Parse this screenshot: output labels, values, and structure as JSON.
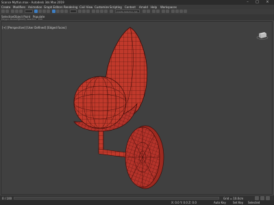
{
  "titlebar": {
    "title": "Sconce Mytfun.max - Autodesk 3ds Max 2019"
  },
  "menu": [
    {
      "key": "create",
      "label": "Create"
    },
    {
      "key": "modifiers",
      "label": "Modifiers"
    },
    {
      "key": "animation",
      "label": "Animation"
    },
    {
      "key": "graph_editors",
      "label": "Graph Editors"
    },
    {
      "key": "rendering",
      "label": "Rendering"
    },
    {
      "key": "civil_view",
      "label": "Civil View"
    },
    {
      "key": "customize",
      "label": "Customize"
    },
    {
      "key": "scripting",
      "label": "Scripting"
    },
    {
      "key": "content",
      "label": "Content"
    },
    {
      "key": "arnold",
      "label": "Arnold"
    },
    {
      "key": "help",
      "label": "Help"
    },
    {
      "key": "workspaces",
      "label": "Workspaces"
    }
  ],
  "toolbar": {
    "selection_set_placeholder": "Create Selection Set"
  },
  "ribbon": {
    "tab1": "Selection",
    "tab2": "Object Paint",
    "tab3": "Populate",
    "sub1": "Polygon Modeling",
    "sub2": "Modify Selection",
    "sub3": "Edit"
  },
  "viewport": {
    "label": "[+] [Perspective] [User Defined] [Edged Faces]"
  },
  "status": {
    "frame": "0 / 100",
    "coords": "X: 0.0  Y: 0.0  Z: 0.0",
    "grid": "Grid = 10.0cm",
    "autokey": "Auto Key",
    "setkey": "Set Key",
    "selected": "Selected"
  },
  "colors": {
    "model": "#c0392b",
    "wire": "#3a0b08",
    "bg": "#404040"
  }
}
